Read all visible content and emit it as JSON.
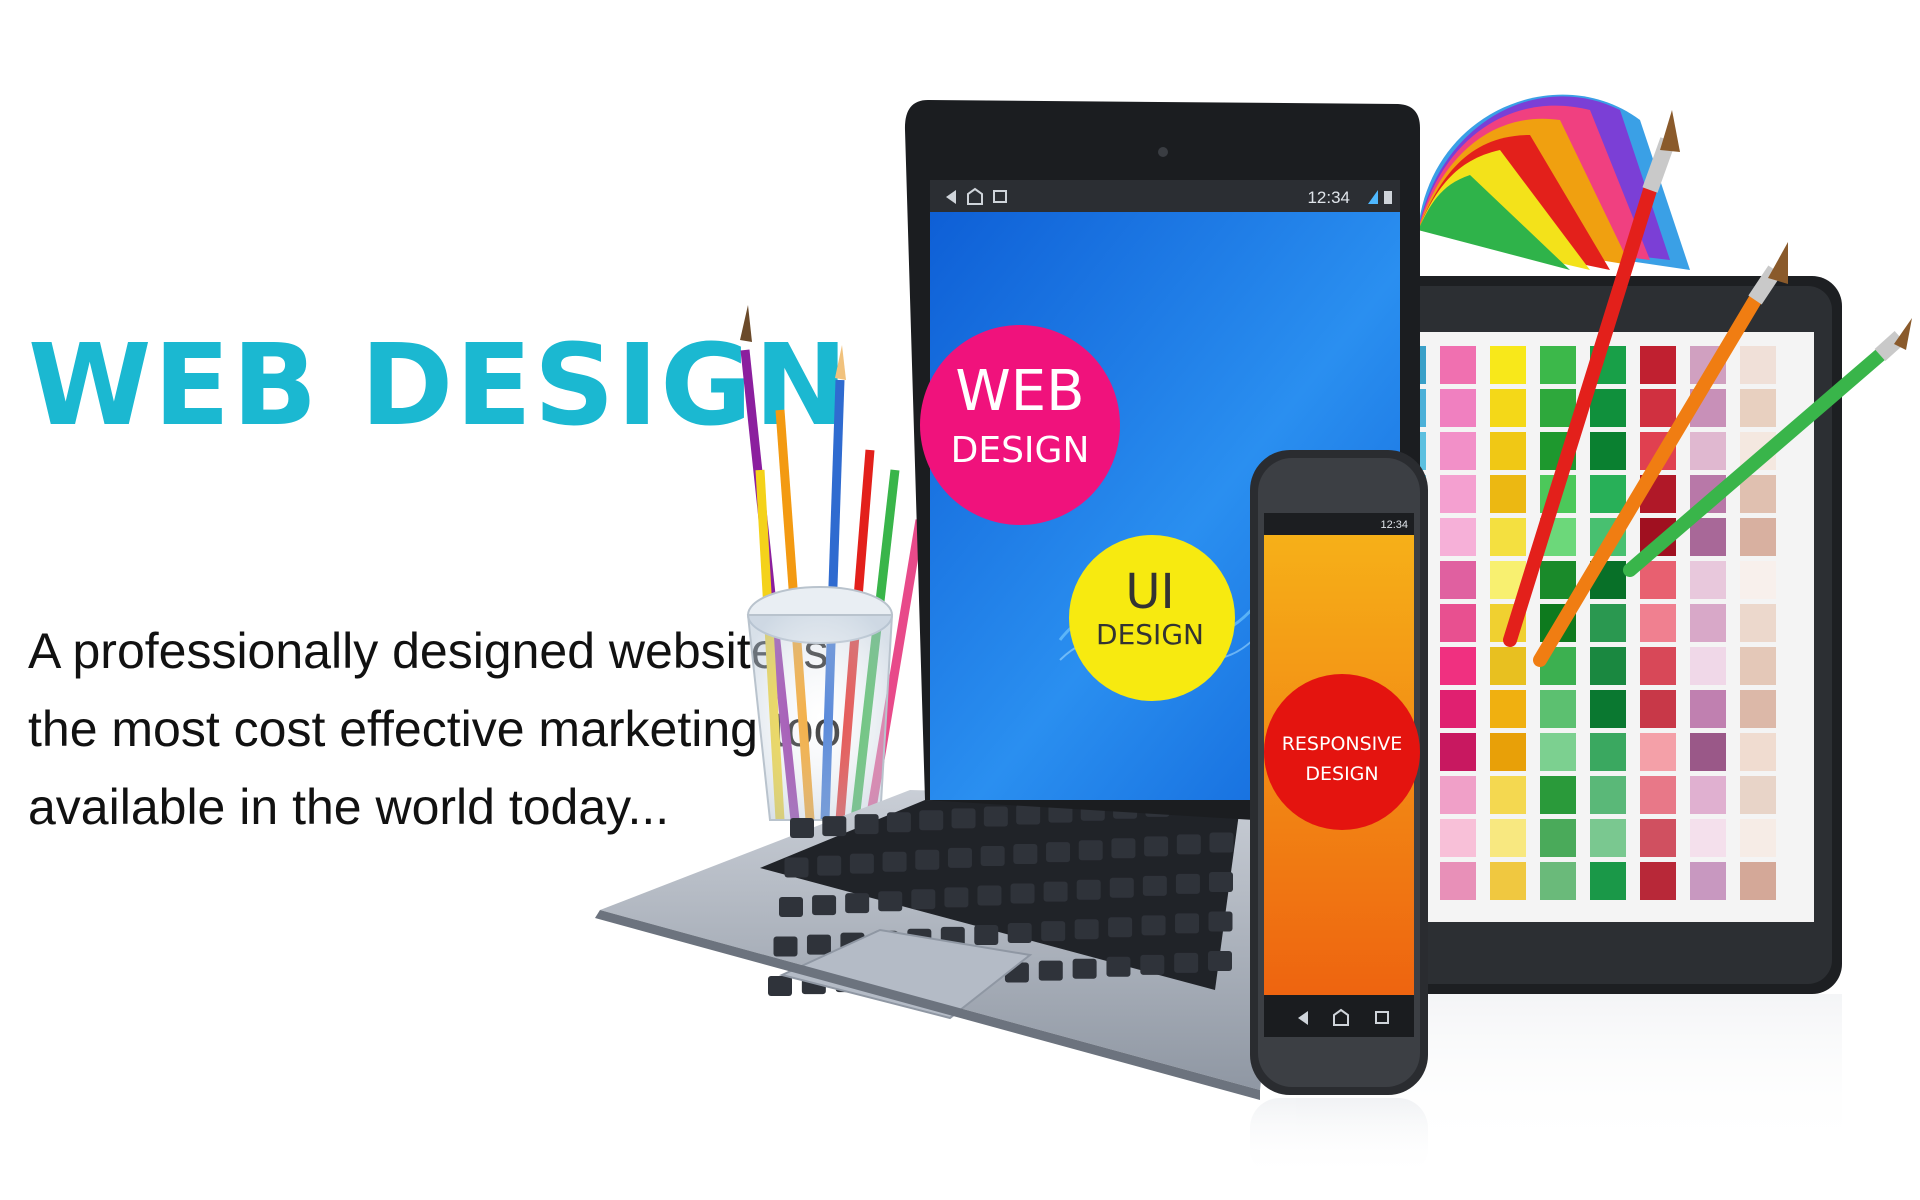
{
  "headline": "WEB DESIGN",
  "tagline_lines": [
    "A professionally designed website is",
    "the most cost effective marketing tool",
    "available in the world today..."
  ],
  "laptop": {
    "status_time": "12:34",
    "bubble_web_line1": "WEB",
    "bubble_web_line2": "DESIGN",
    "bubble_ui_line1": "UI",
    "bubble_ui_line2": "DESIGN"
  },
  "phone": {
    "status_time": "12:34",
    "bubble_line1": "RESPONSIVE",
    "bubble_line2": "DESIGN"
  },
  "colors": {
    "headline": "#1bb8d1",
    "laptop_screen": "#1a7fe6",
    "web_bubble": "#f0127c",
    "ui_bubble": "#f7ea10",
    "phone_screen": "#f28a12",
    "phone_bubble": "#e4140f"
  },
  "icons": [
    "back-icon",
    "home-icon",
    "recent-apps-icon",
    "signal-icon",
    "battery-icon"
  ]
}
